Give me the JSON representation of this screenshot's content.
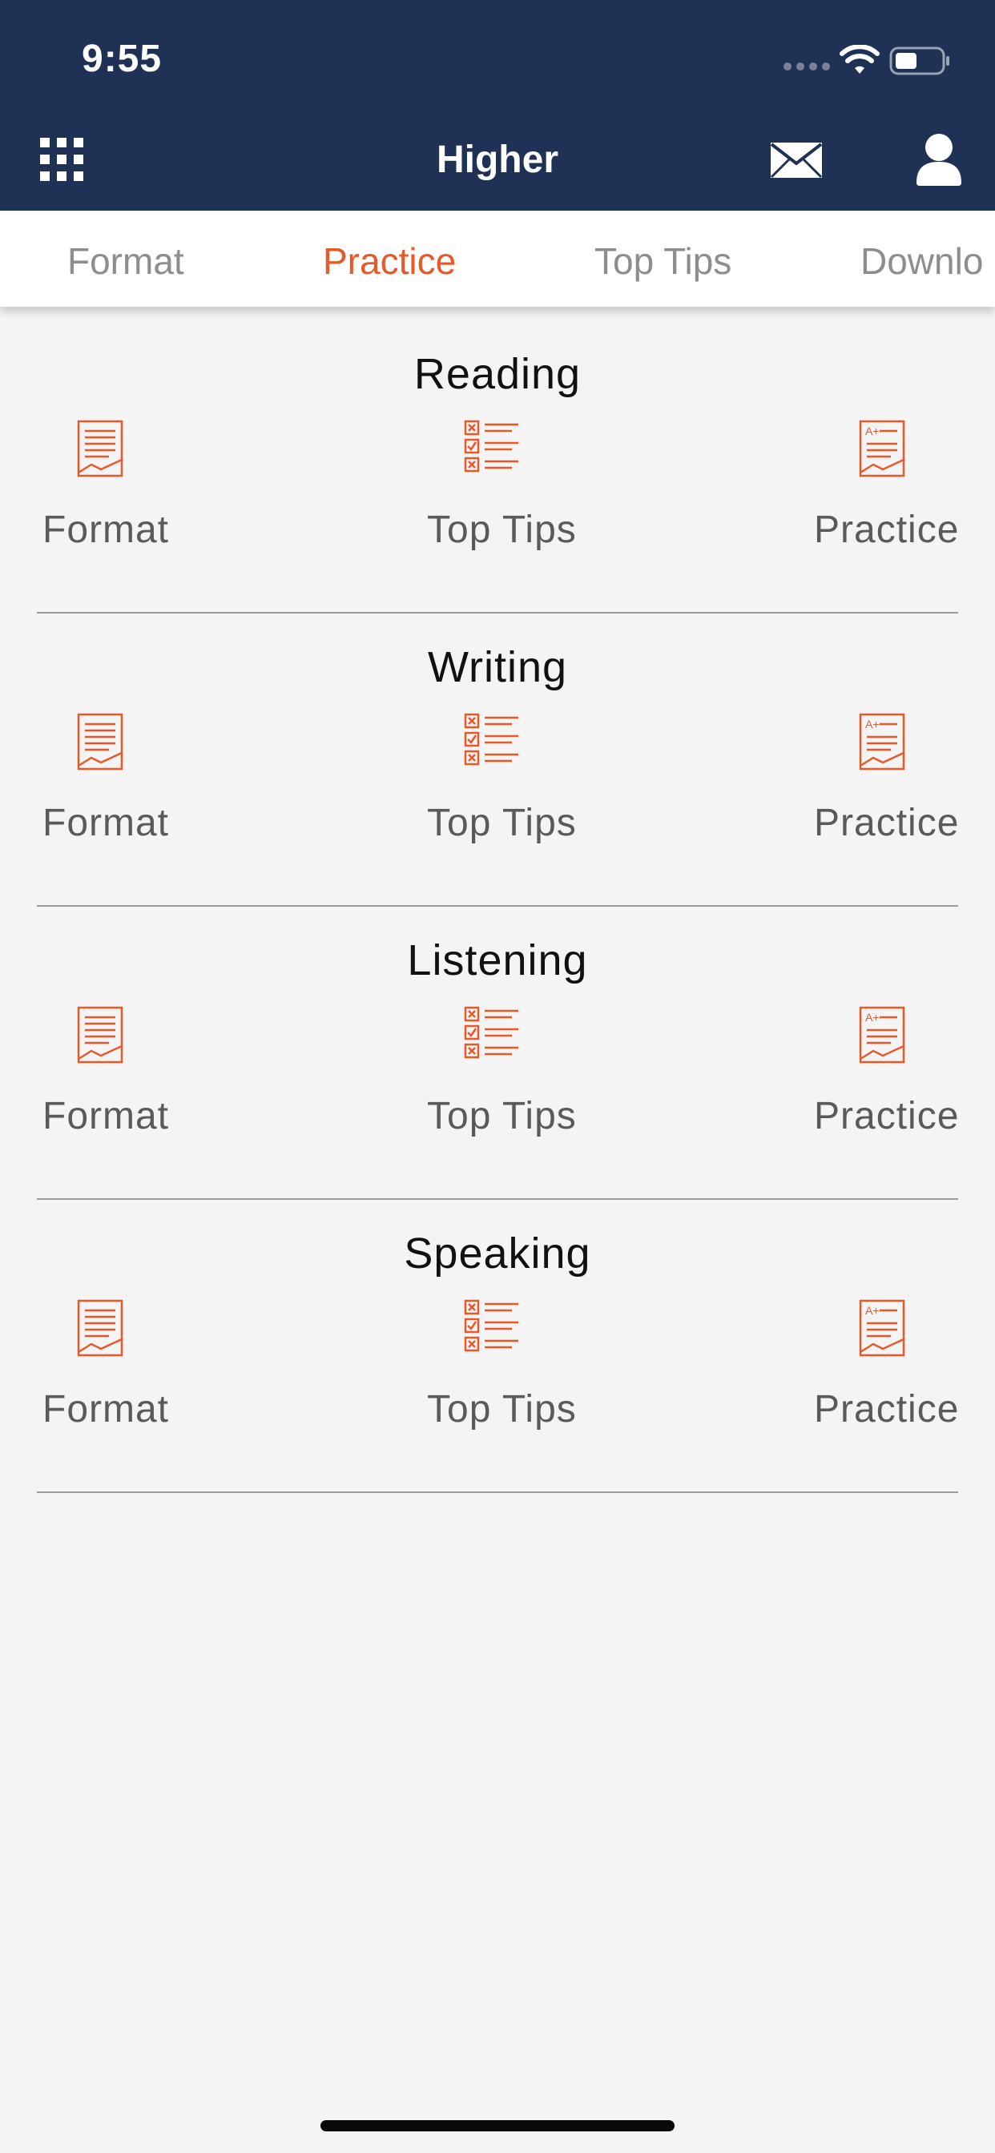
{
  "status_bar": {
    "time": "9:55"
  },
  "header": {
    "title": "Higher"
  },
  "tabs": [
    {
      "label": "Format",
      "active": false
    },
    {
      "label": "Practice",
      "active": true
    },
    {
      "label": "Top Tips",
      "active": false
    },
    {
      "label": "Downlo",
      "active": false
    }
  ],
  "sections": [
    {
      "title": "Reading",
      "items": [
        {
          "label": "Format",
          "icon": "document-icon"
        },
        {
          "label": "Top Tips",
          "icon": "checklist-icon"
        },
        {
          "label": "Practice",
          "icon": "graded-document-icon"
        }
      ]
    },
    {
      "title": "Writing",
      "items": [
        {
          "label": "Format",
          "icon": "document-icon"
        },
        {
          "label": "Top Tips",
          "icon": "checklist-icon"
        },
        {
          "label": "Practice",
          "icon": "graded-document-icon"
        }
      ]
    },
    {
      "title": "Listening",
      "items": [
        {
          "label": "Format",
          "icon": "document-icon"
        },
        {
          "label": "Top Tips",
          "icon": "checklist-icon"
        },
        {
          "label": "Practice",
          "icon": "graded-document-icon"
        }
      ]
    },
    {
      "title": "Speaking",
      "items": [
        {
          "label": "Format",
          "icon": "document-icon"
        },
        {
          "label": "Top Tips",
          "icon": "checklist-icon"
        },
        {
          "label": "Practice",
          "icon": "graded-document-icon"
        }
      ]
    }
  ],
  "colors": {
    "header_bg": "#1f3155",
    "accent": "#e8592a",
    "page_bg": "#f4f4f4"
  }
}
